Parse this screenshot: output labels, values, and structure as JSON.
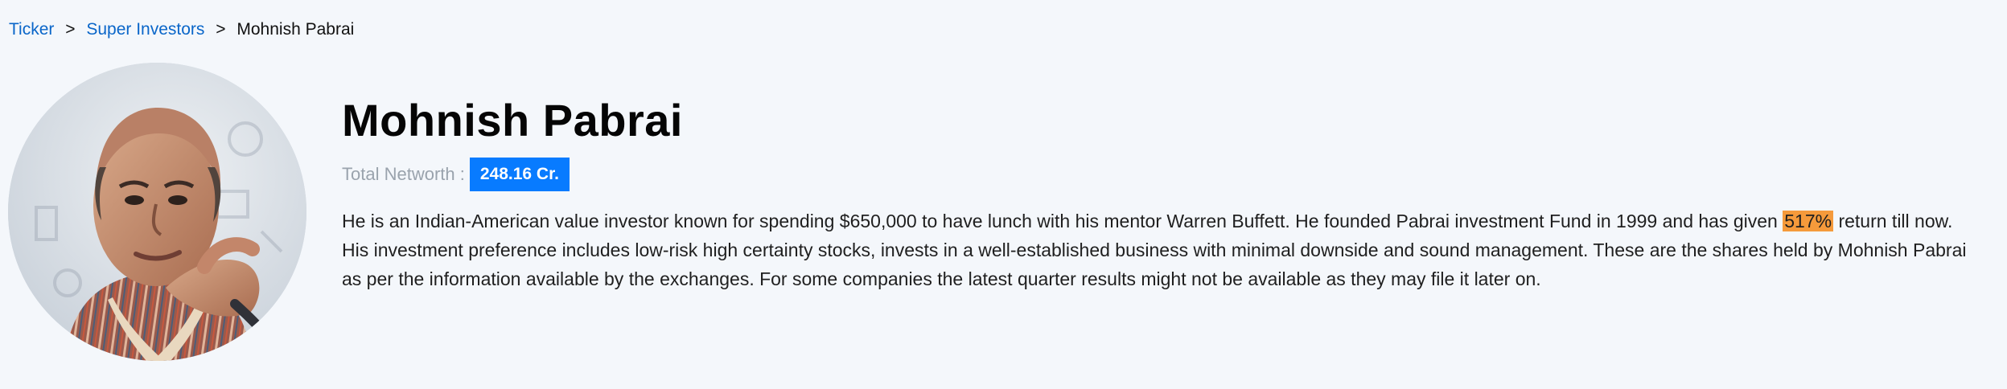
{
  "breadcrumb": {
    "items": [
      {
        "label": "Ticker"
      },
      {
        "label": "Super Investors"
      },
      {
        "label": "Mohnish Pabrai"
      }
    ],
    "separator": ">"
  },
  "profile": {
    "name": "Mohnish Pabrai",
    "networth_label": "Total Networth :",
    "networth_value": "248.16 Cr.",
    "bio_before_highlight": "He is an Indian-American value investor known for spending $650,000 to have lunch with his mentor Warren Buffett. He founded Pabrai investment Fund in 1999 and has given ",
    "bio_highlight": "517%",
    "bio_after_highlight": " return till now. His investment preference includes low-risk high certainty stocks, invests in a well-established business with minimal downside and sound management. These are the shares held by Mohnish Pabrai as per the information available by the exchanges. For some companies the latest quarter results might not be available as they may file it later on."
  },
  "colors": {
    "page_background": "#f4f7fb",
    "link": "#0a66c9",
    "networth_badge": "#087bff",
    "highlight": "#f59a3b",
    "muted_label": "#9aa3ad"
  }
}
